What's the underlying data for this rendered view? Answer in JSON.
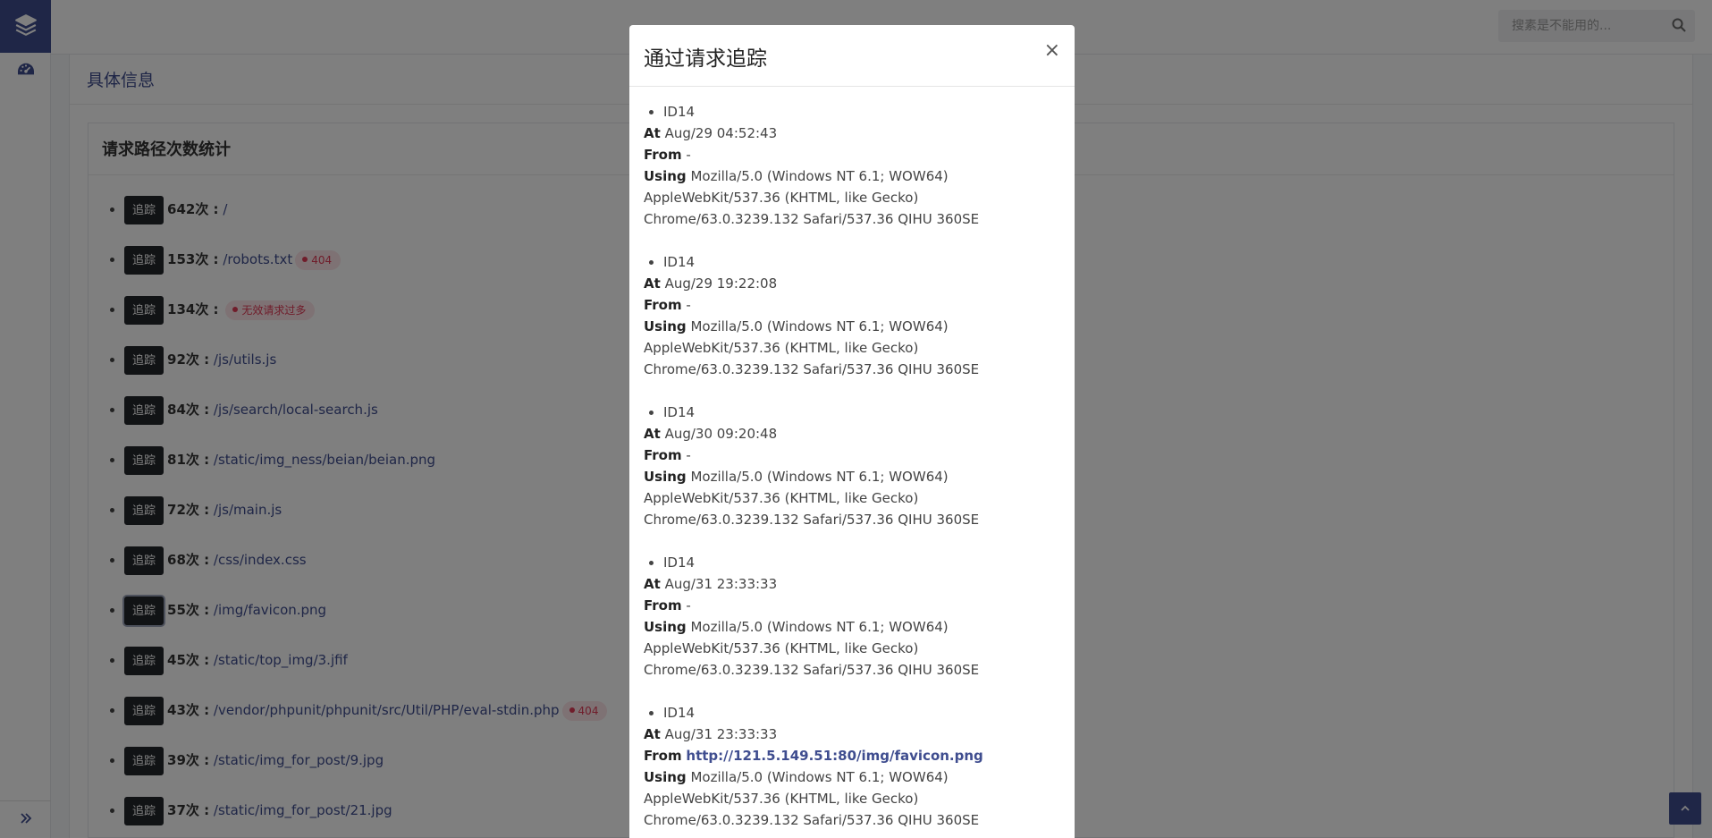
{
  "search": {
    "placeholder": "搜素是不能用的..."
  },
  "main": {
    "title": "具体信息",
    "stat_title": "请求路径次数统计",
    "trace_label": "追踪",
    "items": [
      {
        "count": "642次 :",
        "path": "/",
        "badge": ""
      },
      {
        "count": "153次 :",
        "path": "/robots.txt",
        "badge": "404"
      },
      {
        "count": "134次 :",
        "path": "",
        "badge": "无效请求过多"
      },
      {
        "count": "92次 :",
        "path": "/js/utils.js",
        "badge": ""
      },
      {
        "count": "84次 :",
        "path": "/js/search/local-search.js",
        "badge": ""
      },
      {
        "count": "81次 :",
        "path": "/static/img_ness/beian/beian.png",
        "badge": ""
      },
      {
        "count": "72次 :",
        "path": "/js/main.js",
        "badge": ""
      },
      {
        "count": "68次 :",
        "path": "/css/index.css",
        "badge": ""
      },
      {
        "count": "55次 :",
        "path": "/img/favicon.png",
        "badge": ""
      },
      {
        "count": "45次 :",
        "path": "/static/top_img/3.jfif",
        "badge": ""
      },
      {
        "count": "43次 :",
        "path": "/vendor/phpunit/phpunit/src/Util/PHP/eval-stdin.php",
        "badge": "404"
      },
      {
        "count": "39次 :",
        "path": "/static/img_for_post/9.jpg",
        "badge": ""
      },
      {
        "count": "37次 :",
        "path": "/static/img_for_post/21.jpg",
        "badge": ""
      }
    ]
  },
  "modal": {
    "title": "通过请求追踪",
    "close": "×",
    "labels": {
      "at": "At",
      "from": "From",
      "using": "Using"
    },
    "entries": [
      {
        "id": "ID14",
        "at": "Aug/29 04:52:43",
        "from": "-",
        "from_is_link": false,
        "ua1": "Mozilla/5.0 (Windows NT 6.1; WOW64)",
        "ua2": "AppleWebKit/537.36 (KHTML, like Gecko)",
        "ua3": "Chrome/63.0.3239.132 Safari/537.36 QIHU 360SE"
      },
      {
        "id": "ID14",
        "at": "Aug/29 19:22:08",
        "from": "-",
        "from_is_link": false,
        "ua1": "Mozilla/5.0 (Windows NT 6.1; WOW64)",
        "ua2": "AppleWebKit/537.36 (KHTML, like Gecko)",
        "ua3": "Chrome/63.0.3239.132 Safari/537.36 QIHU 360SE"
      },
      {
        "id": "ID14",
        "at": "Aug/30 09:20:48",
        "from": "-",
        "from_is_link": false,
        "ua1": "Mozilla/5.0 (Windows NT 6.1; WOW64)",
        "ua2": "AppleWebKit/537.36 (KHTML, like Gecko)",
        "ua3": "Chrome/63.0.3239.132 Safari/537.36 QIHU 360SE"
      },
      {
        "id": "ID14",
        "at": "Aug/31 23:33:33",
        "from": "-",
        "from_is_link": false,
        "ua1": "Mozilla/5.0 (Windows NT 6.1; WOW64)",
        "ua2": "AppleWebKit/537.36 (KHTML, like Gecko)",
        "ua3": "Chrome/63.0.3239.132 Safari/537.36 QIHU 360SE"
      },
      {
        "id": "ID14",
        "at": "Aug/31 23:33:33",
        "from": "http://121.5.149.51:80/img/favicon.png",
        "from_is_link": true,
        "ua1": "Mozilla/5.0 (Windows NT 6.1; WOW64)",
        "ua2": "AppleWebKit/537.36 (KHTML, like Gecko)",
        "ua3": "Chrome/63.0.3239.132 Safari/537.36 QIHU 360SE"
      }
    ]
  },
  "colors": {
    "brand": "#3f4d8f",
    "badge_bg": "#fde4e8",
    "badge_fg": "#e03a56",
    "button": "#23262b"
  },
  "icons": {
    "logo": "layers-icon",
    "dashboard": "dashboard-icon",
    "expand": "double-chevron-right-icon",
    "search": "search-icon",
    "back_top": "chevron-up-icon"
  }
}
